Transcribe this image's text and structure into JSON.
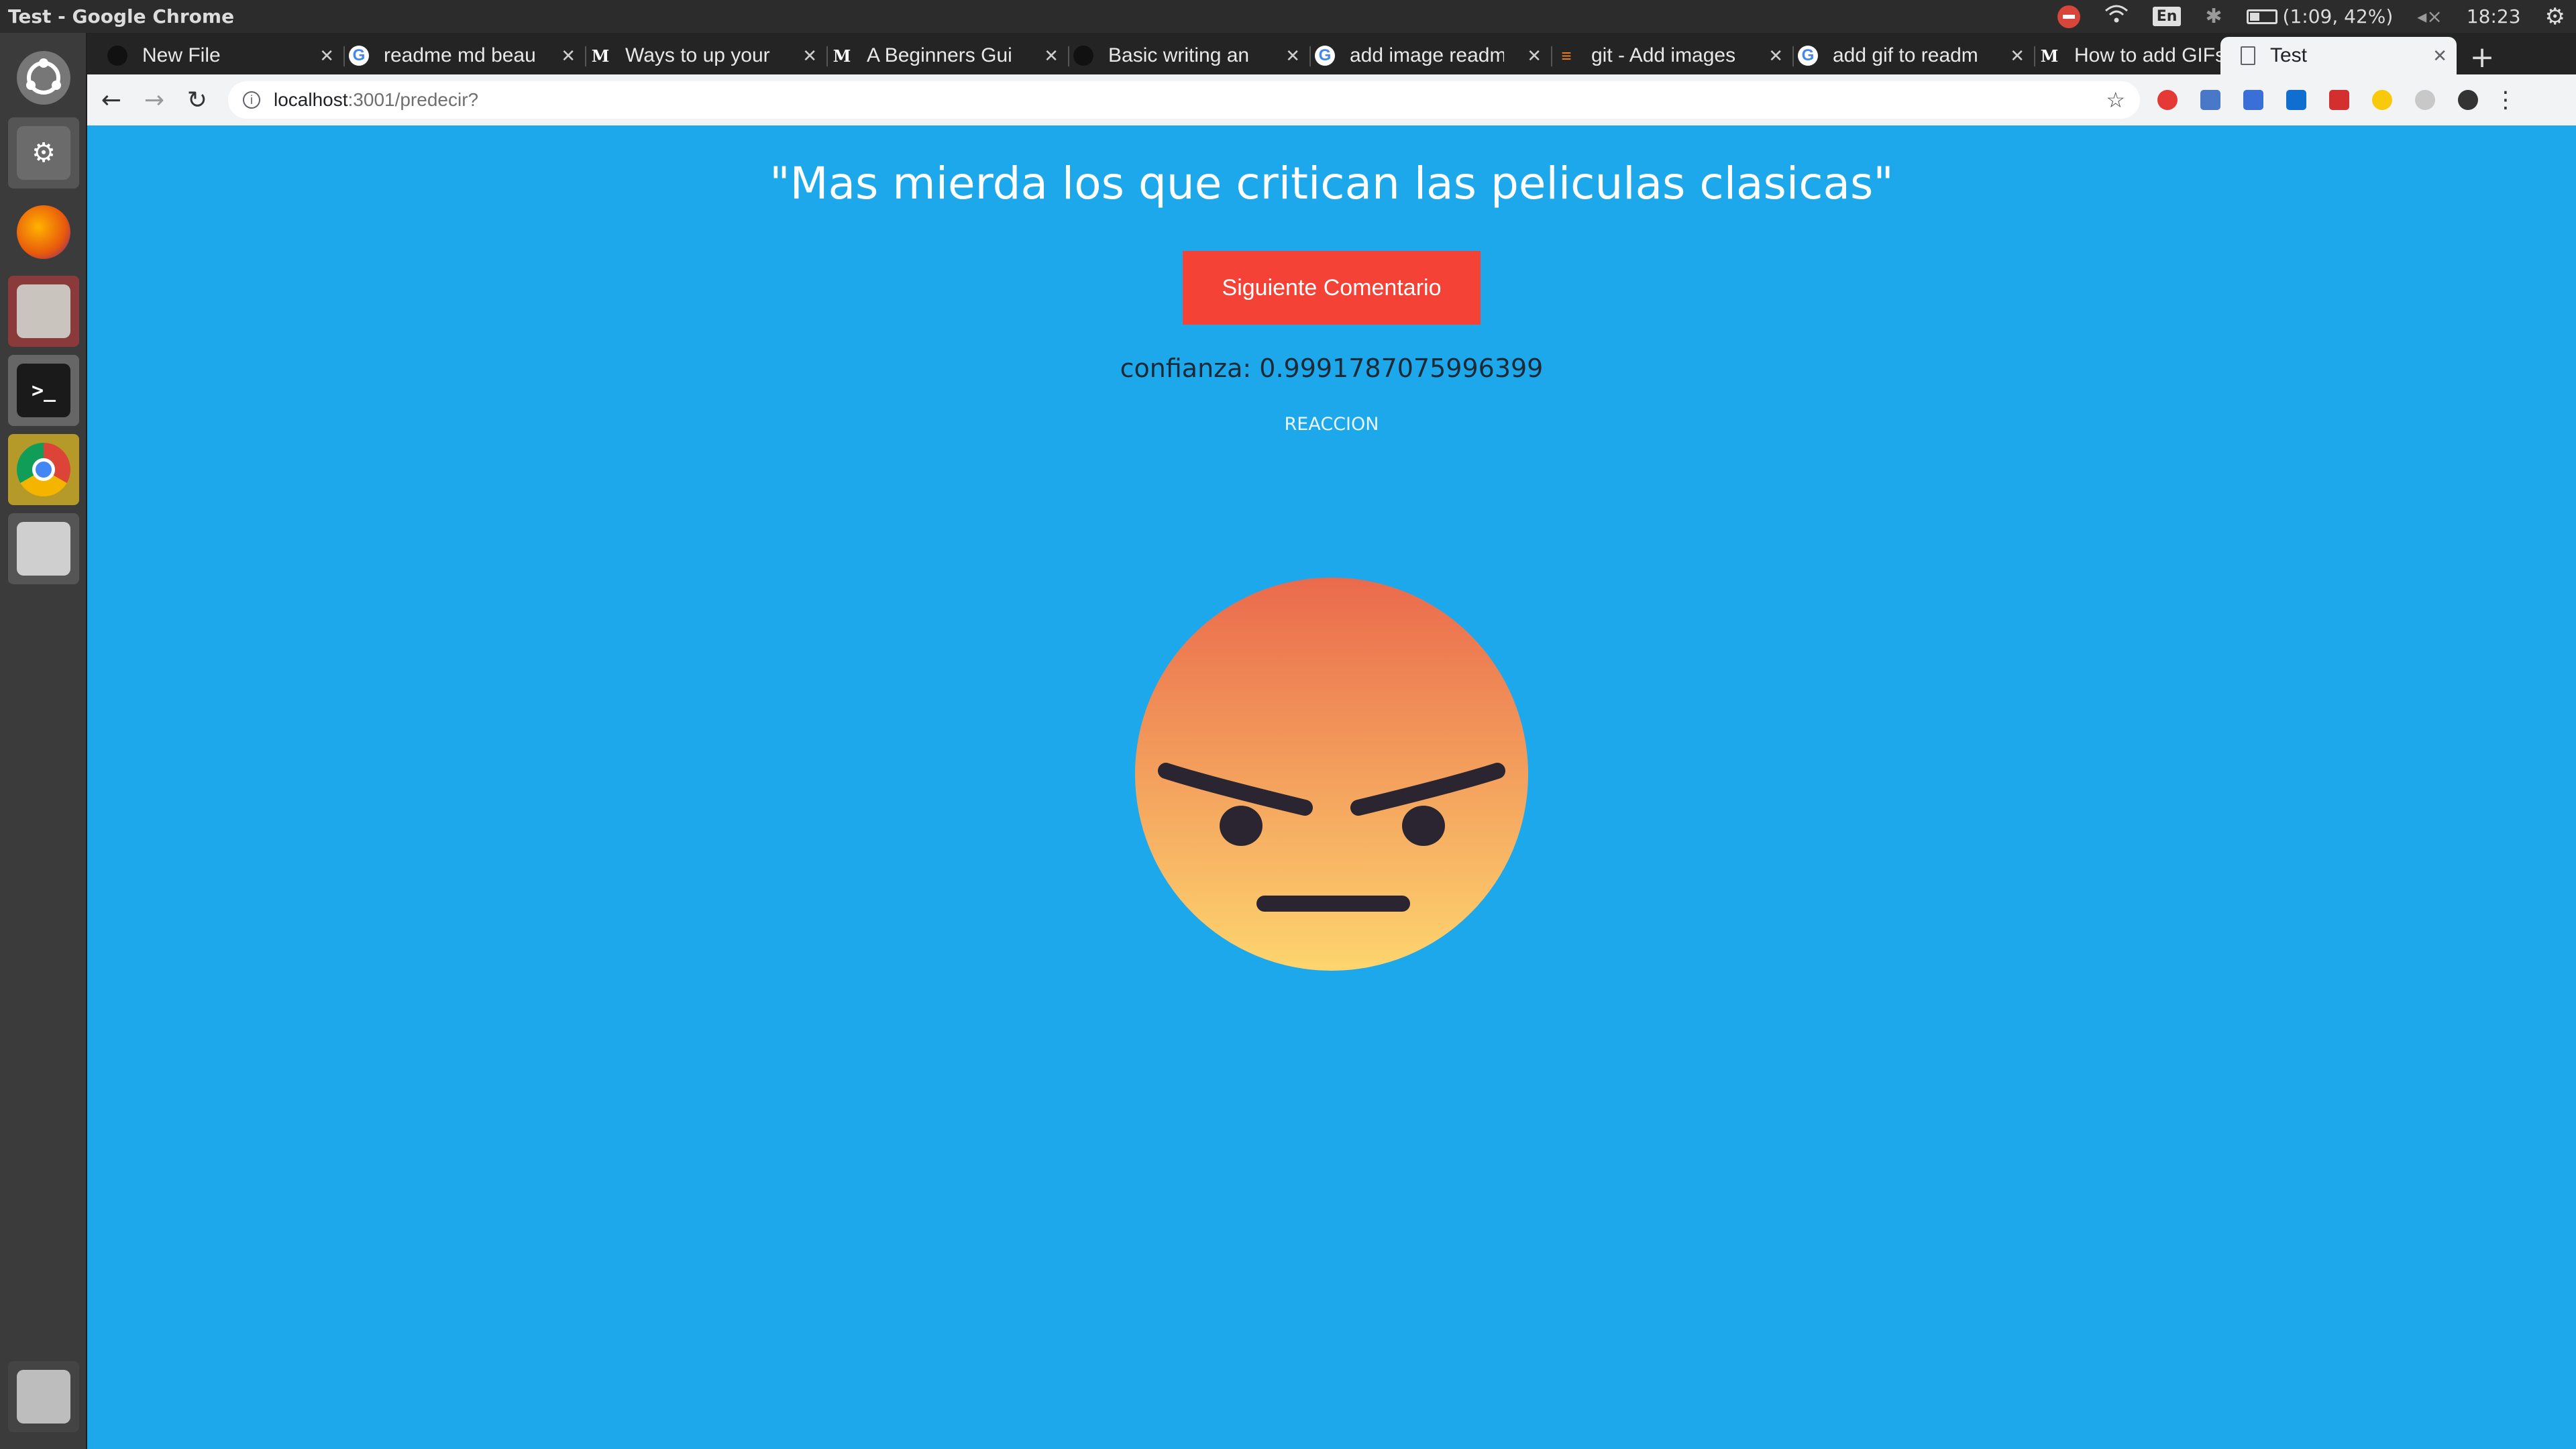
{
  "window": {
    "title": "Test - Google Chrome"
  },
  "system": {
    "battery": "(1:09, 42%)",
    "clock": "18:23",
    "keyboard": "En"
  },
  "tabs": [
    {
      "label": "New File",
      "icon": "github-icon"
    },
    {
      "label": "readme md beau",
      "icon": "google-icon"
    },
    {
      "label": "Ways to up your",
      "icon": "medium-icon"
    },
    {
      "label": "A Beginners Gui",
      "icon": "medium-icon"
    },
    {
      "label": "Basic writing an",
      "icon": "github-icon"
    },
    {
      "label": "add image readm",
      "icon": "google-icon"
    },
    {
      "label": "git - Add images",
      "icon": "stackoverflow-icon"
    },
    {
      "label": "add gif to readm",
      "icon": "google-icon"
    },
    {
      "label": "How to add GIFs",
      "icon": "medium-icon"
    },
    {
      "label": "Test",
      "icon": "page-icon"
    }
  ],
  "address": {
    "host": "localhost",
    "path": ":3001/predecir?"
  },
  "page": {
    "quote": "\"Mas mierda los que critican las peliculas clasicas\"",
    "button_label": "Siguiente Comentario",
    "confidence": "confianza: 0.9991787075996399",
    "reaction_label": "REACCION",
    "reaction_emoji": "angry-face"
  },
  "colors": {
    "page_bg": "#1ea8ec",
    "button_bg": "#f44336",
    "emoji_top": "#ea6a4c",
    "emoji_bottom": "#fdd56e"
  }
}
